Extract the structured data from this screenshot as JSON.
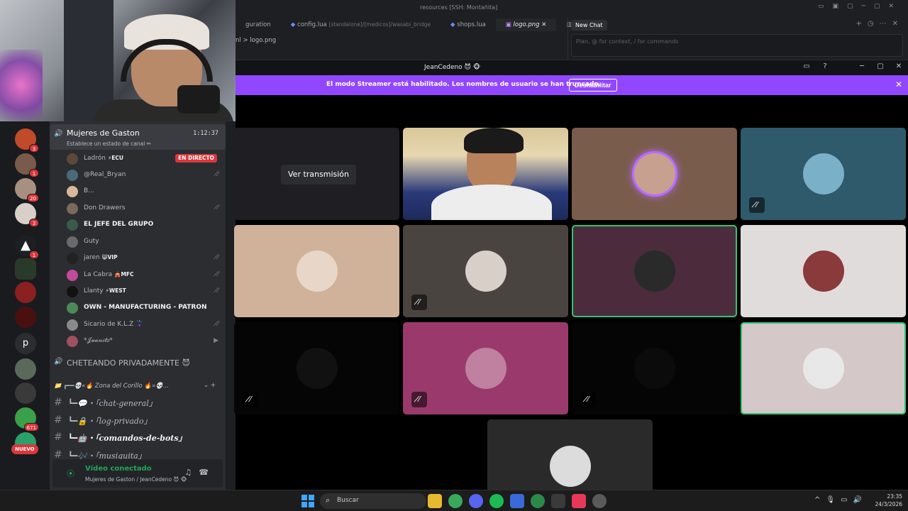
{
  "editor": {
    "window_title": "resources [SSH: Montañita]",
    "tabs": [
      {
        "label": "guration",
        "sub": ""
      },
      {
        "label": "config.lua",
        "sub": "[standalone]/[medicos]/wasabi_bridge"
      },
      {
        "label": "shops.lua",
        "sub": ""
      },
      {
        "label": "logo.png",
        "sub": ""
      }
    ],
    "breadcrumb": "nl > logo.png",
    "new_chat": "New Chat",
    "chat_placeholder": "Plan, @ for context, / for commands"
  },
  "discord": {
    "window_title": "JeanCedeno 😈 🐵",
    "banner_text": "El modo Streamer está habilitado. Los nombres de usuario se han truncado.",
    "banner_button": "Deshabilitar",
    "watch_button": "Ver transmisión",
    "voice_channel": {
      "name": "Mujeres de Gaston",
      "status": "Establece un estado de canal ✏",
      "timer": "1:12:37"
    },
    "live_badge": "EN DIRECTO",
    "members": [
      {
        "name": "Ladrón",
        "tag": "⚡ECU",
        "bold": false,
        "right": "live",
        "color": "#5b4a3a"
      },
      {
        "name": "@Real_Bryan",
        "tag": "",
        "bold": false,
        "right": "🎙̸",
        "color": "#4a6a7a"
      },
      {
        "name": "B...",
        "tag": "",
        "bold": false,
        "right": "",
        "color": "#d8b79a"
      },
      {
        "name": "Don Drawers",
        "tag": "",
        "bold": false,
        "right": "🎙̸",
        "color": "#7a6a5a"
      },
      {
        "name": "EL JEFE DEL GRUPO",
        "tag": "",
        "bold": true,
        "right": "",
        "color": "#3a5a4a"
      },
      {
        "name": "Guty",
        "tag": "",
        "bold": false,
        "right": "",
        "color": "#6a6a6a"
      },
      {
        "name": "jaren",
        "tag": "😸VIP",
        "bold": false,
        "right": "🎙̸",
        "color": "#222"
      },
      {
        "name": "La Cabra",
        "tag": "🎪MFC",
        "bold": false,
        "right": "🎙̸",
        "color": "#c24a9a"
      },
      {
        "name": "Llanty",
        "tag": "⚡WEST",
        "bold": false,
        "right": "🎙̸",
        "color": "#111"
      },
      {
        "name": "OWN - MANUFACTURING - PATRON",
        "tag": "",
        "bold": true,
        "right": "",
        "color": "#4a8a5a"
      },
      {
        "name": "Sicario de K.L.Z 🦹",
        "tag": "",
        "bold": false,
        "right": "🎙̸",
        "color": "#8a8a8a"
      },
      {
        "name": "*𝒥𝓊𝒶𝓃𝒾𝓉𝑜*",
        "tag": "",
        "bold": false,
        "right": "📹",
        "color": "#a05060"
      }
    ],
    "second_voice": "CHETEANDO PRIVADAMENTE 😈",
    "category": "📁 ┏━━💀«🔥 Zona del Corillo 🔥»💀...",
    "text_channels": [
      {
        "name": "┗━💬・「chat-general」",
        "bold": false
      },
      {
        "name": "┗━🔒・「log-privado」",
        "bold": false
      },
      {
        "name": "┗━🤖・「comandos-de-bots」",
        "bold": true
      },
      {
        "name": "┗━🎶・「musiquita」",
        "bold": false
      }
    ],
    "guild_badges": [
      "3",
      "1",
      "20",
      "3",
      "1",
      "671"
    ],
    "guild_letter": "p",
    "nuevo_badge": "NUEVO",
    "connection": {
      "title": "Vídeo conectado",
      "sub": "Mujeres de Gaston / JeanCedeno 😈 🐵"
    }
  },
  "taskbar": {
    "search_placeholder": "Buscar",
    "time": "23:35",
    "date": "24/3/2026"
  },
  "colors": {
    "banner": "#9147ff",
    "live": "#da373c",
    "connected": "#23a559",
    "speaking": "#2dc770"
  }
}
